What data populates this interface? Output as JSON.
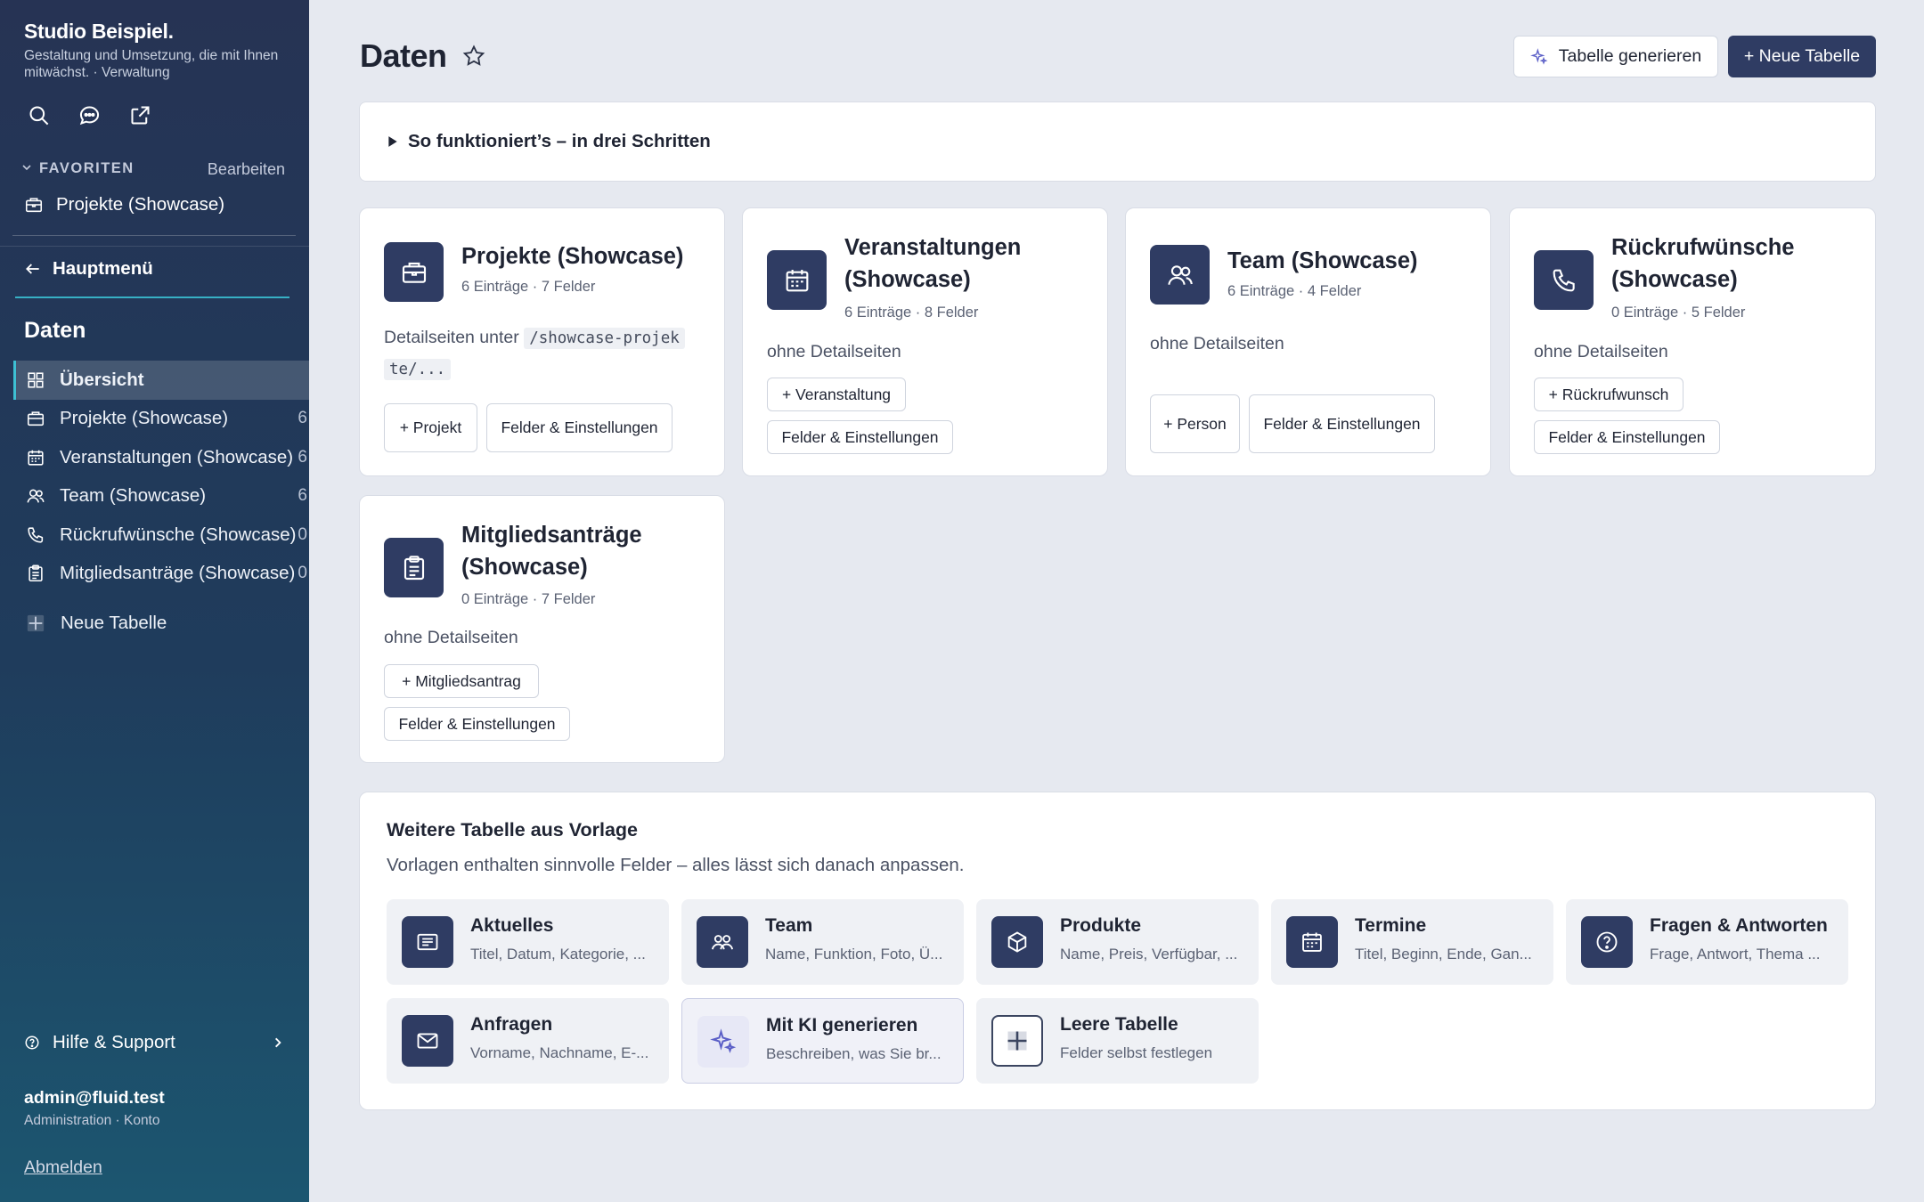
{
  "sidebar": {
    "brand_title": "Studio Beispiel.",
    "brand_subtitle": "Gestaltung und Umsetzung, die mit Ihnen mitwächst. · Verwaltung",
    "favorites_label": "FAVORITEN",
    "favorites_edit": "Bearbeiten",
    "favorite_item": "Projekte (Showcase)",
    "main_menu": "Hauptmenü",
    "section_title": "Daten",
    "nav_items": [
      {
        "label": "Übersicht",
        "count": "",
        "icon": "grid-icon",
        "active": true
      },
      {
        "label": "Projekte (Showcase)",
        "count": "6",
        "icon": "briefcase-icon"
      },
      {
        "label": "Veranstaltungen (Showcase)",
        "count": "6",
        "icon": "calendar-icon"
      },
      {
        "label": "Team (Showcase)",
        "count": "6",
        "icon": "users-icon"
      },
      {
        "label": "Rückrufwünsche (Showcase)",
        "count": "0",
        "icon": "phone-icon"
      },
      {
        "label": "Mitgliedsanträge (Showcase)",
        "count": "0",
        "icon": "clipboard-icon"
      }
    ],
    "new_table": "Neue Tabelle",
    "help": "Hilfe & Support",
    "user_email": "admin@fluid.test",
    "user_role": "Administration · Konto",
    "logout": "Abmelden"
  },
  "header": {
    "title": "Daten",
    "generate_button": "Tabelle generieren",
    "new_button": "+ Neue Tabelle"
  },
  "howto": "So funktioniert’s – in drei Schritten",
  "cards": [
    {
      "title": "Projekte (Showcase)",
      "meta": "6 Einträge · 7 Felder",
      "desc_prefix": "Detailseiten unter",
      "desc_code_1": "/showcase-projek",
      "desc_code_2": "te/...",
      "add": "+ Projekt",
      "settings": "Felder & Einstellungen"
    },
    {
      "title_1": "Veranstaltungen",
      "title_2": "(Showcase)",
      "meta": "6 Einträge · 8 Felder",
      "desc": "ohne Detailseiten",
      "add": "+ Veranstaltung",
      "settings": "Felder & Einstellungen"
    },
    {
      "title": "Team (Showcase)",
      "meta": "6 Einträge · 4 Felder",
      "desc": "ohne Detailseiten",
      "add": "+ Person",
      "settings": "Felder & Einstellungen"
    },
    {
      "title_1": "Rückrufwünsche",
      "title_2": "(Showcase)",
      "meta": "0 Einträge · 5 Felder",
      "desc": "ohne Detailseiten",
      "add": "+ Rückrufwunsch",
      "settings": "Felder & Einstellungen"
    },
    {
      "title_1": "Mitgliedsanträge",
      "title_2": "(Showcase)",
      "meta": "0 Einträge · 7 Felder",
      "desc": "ohne Detailseiten",
      "add": "+ Mitgliedsantrag",
      "settings": "Felder & Einstellungen"
    }
  ],
  "templates": {
    "heading": "Weitere Tabelle aus Vorlage",
    "subtitle": "Vorlagen enthalten sinnvolle Felder – alles lässt sich danach anpassen.",
    "items": [
      {
        "name": "Aktuelles",
        "desc": "Titel, Datum, Kategorie, ...",
        "icon": "newspaper-icon"
      },
      {
        "name": "Team",
        "desc": "Name, Funktion, Foto, Ü...",
        "icon": "users-icon"
      },
      {
        "name": "Produkte",
        "desc": "Name, Preis, Verfügbar, ...",
        "icon": "box-icon"
      },
      {
        "name": "Termine",
        "desc": "Titel, Beginn, Ende, Gan...",
        "icon": "calendar-icon"
      },
      {
        "name": "Fragen & Antworten",
        "desc": "Frage, Antwort, Thema ...",
        "icon": "question-icon"
      },
      {
        "name": "Anfragen",
        "desc": "Vorname, Nachname, E-...",
        "icon": "mail-icon"
      },
      {
        "name": "Mit KI generieren",
        "desc": "Beschreiben, was Sie br...",
        "icon": "sparkle-icon"
      },
      {
        "name": "Leere Tabelle",
        "desc": "Felder selbst festlegen",
        "icon": "plus-grid-icon"
      }
    ]
  },
  "colors": {
    "accent": "#2f3c63",
    "sidebar_top": "#263354",
    "sidebar_bottom": "#1c5670",
    "active_bar": "#3ec0d3"
  }
}
